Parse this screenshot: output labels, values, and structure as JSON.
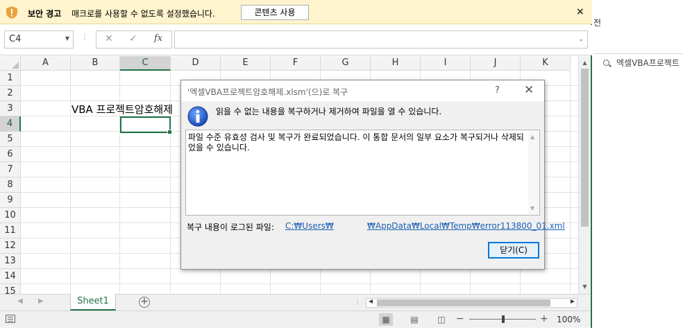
{
  "security_bar": {
    "title": "보안 경고",
    "message": "매크로를 사용할 수 없도록 설정했습니다.",
    "button_label": "콘텐츠 사용",
    "close_glyph": "×"
  },
  "formula_bar": {
    "name_box": "C4",
    "cancel_glyph": "✕",
    "enter_glyph": "✓",
    "fx_label": "fx",
    "formula_value": ""
  },
  "grid": {
    "columns": [
      "A",
      "B",
      "C",
      "D",
      "E",
      "F",
      "G",
      "H",
      "I",
      "J",
      "K"
    ],
    "rows": [
      "1",
      "2",
      "3",
      "4",
      "5",
      "6",
      "7",
      "8",
      "9",
      "10",
      "11",
      "12",
      "13",
      "14",
      "15"
    ],
    "selected_cell": "C4",
    "cells": {
      "B3": "VBA 프로젝트암호해제"
    }
  },
  "sheet_tabs": {
    "active": "Sheet1",
    "tabs": [
      "Sheet1"
    ],
    "add_glyph": "+"
  },
  "status_bar": {
    "zoom_minus": "−",
    "zoom_plus": "+",
    "zoom_label": "100%",
    "zoom_level_percent": 100
  },
  "dialog": {
    "title": "'엑셀VBA프로젝트암호해제.xlsm'(으)로 복구",
    "help_glyph": "?",
    "close_glyph": "✕",
    "heading": "읽을 수 없는 내용을 복구하거나 제거하여 파일을 열 수 있습니다.",
    "body": "파일 수준 유효성 검사 및 복구가 완료되었습니다. 이 통합 문서의 일부 요소가 복구되거나 삭제되었을 수 있습니다.",
    "log_label": "복구 내용이 로그된 파일:",
    "log_link_part1": "C:₩Users₩",
    "log_link_part2": "₩AppData₩Local₩Temp₩error113800_01.xml",
    "close_button": "닫기(C)"
  },
  "right_pane": {
    "top_text": "전",
    "search_text": "엑셀VBA프로젝트"
  },
  "colors": {
    "excel_green": "#217346",
    "security_bar_bg": "#fff4ce",
    "link_blue": "#1a5fb4",
    "dialog_bg": "#f0f0f0"
  }
}
